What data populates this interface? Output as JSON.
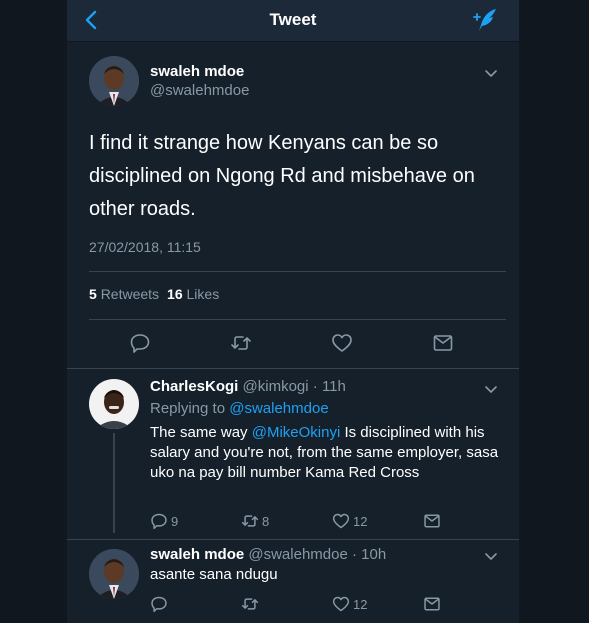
{
  "navbar": {
    "title": "Tweet",
    "back_icon": "chevron-left-icon",
    "compose_icon": "compose-feather-icon",
    "accent": "#1da1f2"
  },
  "main_tweet": {
    "name": "swaleh mdoe",
    "handle": "@swalehmdoe",
    "text": "I find it strange how Kenyans can be so disciplined on Ngong Rd and misbehave on other roads.",
    "timestamp": "27/02/2018, 11:15",
    "retweets_count": "5",
    "retweets_label": "Retweets",
    "likes_count": "16",
    "likes_label": "Likes"
  },
  "replies": [
    {
      "name": "CharlesKogi",
      "handle": "@kimkogi",
      "time": "· 11h",
      "replying_prefix": "Replying to",
      "replying_handle": "@swalehmdoe",
      "text_before": "The same way ",
      "mention": "@MikeOkinyi",
      "text_after": " Is disciplined with his salary and you're not, from the same employer, sasa uko na pay bill number Kama Red Cross",
      "replies_count": "9",
      "retweets_count": "8",
      "likes_count": "12"
    },
    {
      "name": "swaleh mdoe",
      "handle": "@swalehmdoe",
      "time": "· 10h",
      "text": "asante sana ndugu",
      "likes_count": "12"
    }
  ],
  "colors": {
    "background": "#15202b",
    "secondary_text": "#8899a6",
    "divider": "#38444d"
  }
}
